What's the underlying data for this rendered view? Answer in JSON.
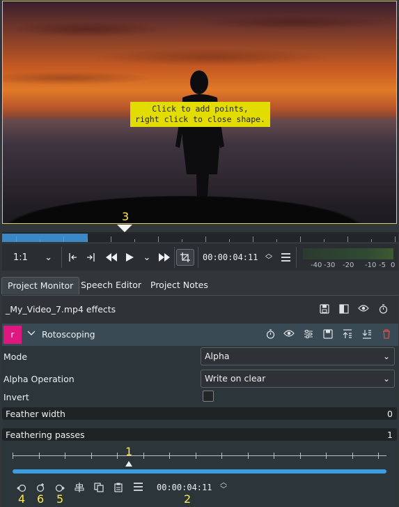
{
  "monitor": {
    "hint_line1": "Click to add points,",
    "hint_line2": "right click to close shape."
  },
  "markers": {
    "m1": "1",
    "m2": "2",
    "m3": "3",
    "m4": "4",
    "m5": "5",
    "m6": "6"
  },
  "transport": {
    "zoom": "1:1",
    "timecode": "00:00:04:11",
    "meter_labels": [
      "-40",
      "-30",
      "-20",
      "-10",
      "-5",
      "0"
    ]
  },
  "tabs": [
    {
      "label": "Project Monitor",
      "active": true
    },
    {
      "label": "Speech Editor",
      "active": false
    },
    {
      "label": "Project Notes",
      "active": false
    }
  ],
  "effects": {
    "title": "_My_Video_7.mp4 effects",
    "effect": {
      "badge": "r",
      "name": "Rotoscoping",
      "params": {
        "mode_label": "Mode",
        "mode_value": "Alpha",
        "alpha_op_label": "Alpha Operation",
        "alpha_op_value": "Write on clear",
        "invert_label": "Invert",
        "invert_checked": false,
        "feather_width_label": "Feather width",
        "feather_width_value": "0",
        "feather_passes_label": "Feathering passes",
        "feather_passes_value": "1"
      }
    },
    "keyframe_timecode": "00:00:04:11"
  },
  "colors": {
    "accent": "#3b9de0",
    "badge": "#e0177e",
    "hint_bg": "#e2dc00",
    "marker": "#ffe84a",
    "delete": "#d9534f"
  }
}
